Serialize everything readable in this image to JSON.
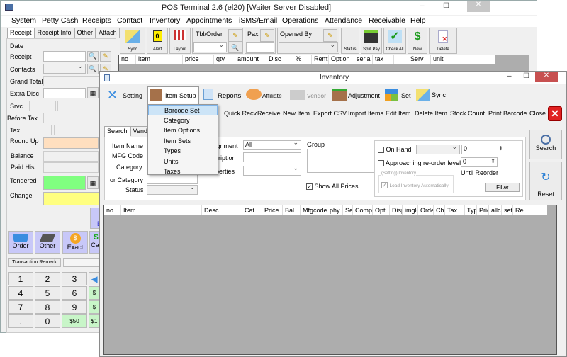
{
  "main_window": {
    "title": "POS Terminal 2.6 (el20) [Waiter Server Disabled]",
    "menu": [
      "System",
      "Petty Cash",
      "Receipts",
      "Contact",
      "Inventory",
      "Appointments",
      "iSMS/Email",
      "Operations",
      "Attendance",
      "Receivable",
      "Help"
    ],
    "left_tabs": [
      "Receipt",
      "Receipt Info",
      "Other",
      "Attach"
    ],
    "fields": {
      "date": "Date",
      "receipt": "Receipt",
      "contacts": "Contacts",
      "grand_total": "Grand Total",
      "extra_disc": "Extra Disc",
      "srvc": "Srvc",
      "before_tax": "Before Tax",
      "tax": "Tax",
      "round_up": "Round Up",
      "balance": "Balance",
      "paid_hist": "Paid Hist",
      "tendered": "Tendered",
      "change": "Change"
    },
    "payment_buttons": [
      "Order",
      "Other",
      "Exact",
      "Ca"
    ],
    "partial_button": "E",
    "transaction_remark": "Transaction Remark",
    "keypad": [
      "1",
      "2",
      "3",
      "4",
      "5",
      "6",
      "7",
      "8",
      "9",
      ".",
      "0",
      "$50"
    ],
    "keypad_side": [
      "$",
      "$",
      "$1"
    ],
    "toolbar": {
      "sync": "Sync",
      "alert": "Alert",
      "alert_count": "0",
      "layout": "Layout",
      "tbl_order": "Tbl/Order",
      "pax": "Pax",
      "opened_by": "Opened By",
      "status": "Status",
      "split_pay": "Split Pay",
      "check_all": "Check All",
      "new": "New",
      "delete": "Delete"
    },
    "grid_columns": [
      "no",
      "item",
      "price",
      "qty",
      "amount",
      "Disc",
      "%",
      "Rem:",
      "Option",
      "seria",
      "tax",
      "",
      "Serv",
      "unit"
    ],
    "colors": {
      "round_up": "#ffdfbf",
      "tendered": "#80ff80",
      "change": "#ffff80",
      "keypad_money": "#c8f5c8",
      "pay_button": "#c8c8f8"
    }
  },
  "inventory_window": {
    "title": "Inventory",
    "toolbar": [
      "Setting",
      "Item Setup",
      "Reports",
      "Affiliate",
      "Vendor",
      "Adjustment",
      "Set",
      "Sync"
    ],
    "actions": [
      "s",
      "Quick Recv",
      "Receive",
      "New Item",
      "Export CSV",
      "Import Items",
      "Edit Item",
      "Delete Item",
      "Stock Count",
      "Print Barcode",
      "Close"
    ],
    "item_setup_menu": [
      "Barcode Set",
      "Category",
      "Item Options",
      "Item Sets",
      "Types",
      "Units",
      "Taxes"
    ],
    "item_setup_selected": "Barcode Set",
    "search_tabs": [
      "Search",
      "Vend"
    ],
    "search_fields": {
      "item_name": "Item Name",
      "mfg_code": "MFG Code",
      "category": "Category",
      "or_category": "or Category",
      "status": "Status",
      "assignment": "signment",
      "assignment_value": "All",
      "description": "scription",
      "properties": "operties",
      "group": "Group",
      "show_all_prices": "Show All Prices",
      "show_all_prices_checked": true
    },
    "filter": {
      "on_hand": "On Hand",
      "on_hand_checked": false,
      "on_hand_value": "0",
      "approaching": "Approaching re-order level",
      "approaching_checked": false,
      "approaching_value": "0",
      "until_reorder": "Until Reorder",
      "setting_group": "(Setting) Inventory",
      "load_auto": "Load Inventory Automatically",
      "load_auto_checked": true,
      "filter_button": "Filter"
    },
    "search_button": "Search",
    "reset_button": "Reset",
    "grid_columns": [
      "no",
      "Item",
      "Desc",
      "Cat",
      "Price",
      "Bal",
      "Mfgcode",
      "phy.",
      "Se",
      "Comp",
      "Opt.",
      "Disp",
      "imglc",
      "Orde",
      "Cha",
      "Tax",
      "Typ",
      "Pric",
      "allc",
      "set",
      "Rec"
    ]
  }
}
